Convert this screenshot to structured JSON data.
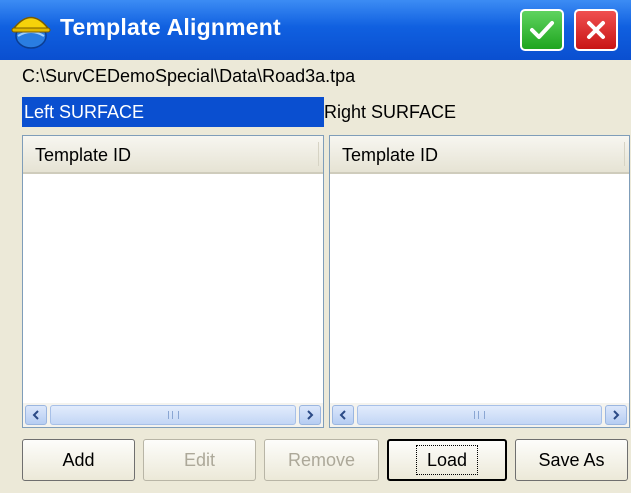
{
  "window": {
    "title": "Template Alignment",
    "icons": {
      "app": "hard-hat-globe-icon",
      "ok": "checkmark-icon",
      "cancel": "close-icon"
    },
    "colors": {
      "titlebar": "#1060e0",
      "ok": "#1fa51f",
      "cancel": "#c81515",
      "selection": "#0a4fd0"
    }
  },
  "file_path": "C:\\SurvCEDemoSpecial\\Data\\Road3a.tpa",
  "surfaces": {
    "left": "Left SURFACE",
    "right": "Right SURFACE"
  },
  "lists": {
    "left": {
      "header": "Template ID",
      "items": []
    },
    "right": {
      "header": "Template ID",
      "items": []
    }
  },
  "buttons": {
    "add": "Add",
    "edit": "Edit",
    "remove": "Remove",
    "load": "Load",
    "save_as": "Save As"
  }
}
